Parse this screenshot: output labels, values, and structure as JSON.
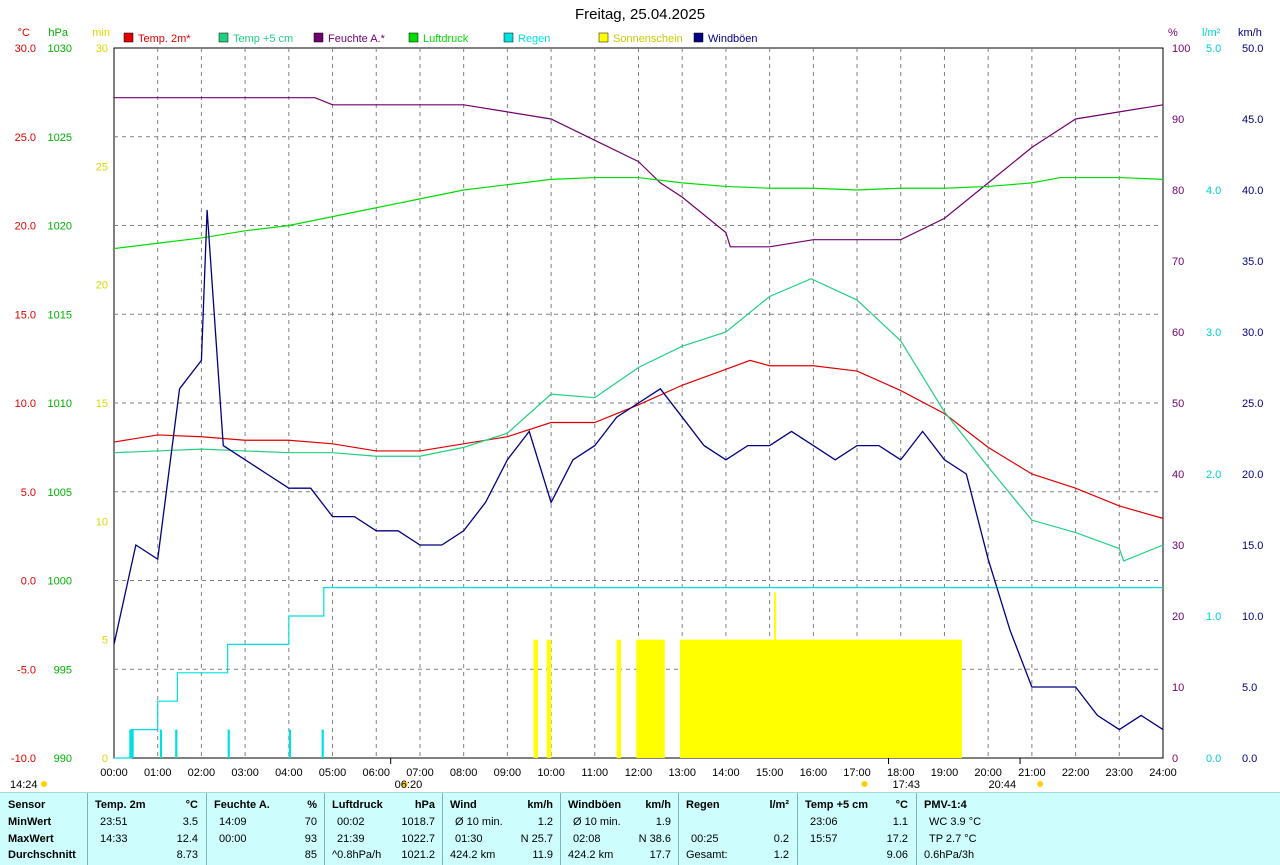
{
  "title": "Freitag, 25.04.2025",
  "colors": {
    "temp": "#e00000",
    "temp5": "#20d080",
    "hum": "#700070",
    "press": "#00dd00",
    "rain": "#00e0e0",
    "sun": "#ffff00",
    "wind": "#000080"
  },
  "chart_data": {
    "type": "line",
    "title": "Freitag, 25.04.2025",
    "x_ticks": [
      "00:00",
      "01:00",
      "02:00",
      "03:00",
      "04:00",
      "05:00",
      "06:00",
      "07:00",
      "08:00",
      "09:00",
      "10:00",
      "11:00",
      "12:00",
      "13:00",
      "14:00",
      "15:00",
      "16:00",
      "17:00",
      "18:00",
      "19:00",
      "20:00",
      "21:00",
      "22:00",
      "23:00",
      "24:00"
    ],
    "axes": {
      "temp_c": {
        "unit": "°C",
        "range": [
          -10,
          30
        ],
        "ticks": [
          "30.0",
          "25.0",
          "20.0",
          "15.0",
          "10.0",
          "5.0",
          "0.0",
          "-5.0",
          "-10.0"
        ]
      },
      "pressure_hpa": {
        "unit": "hPa",
        "range": [
          990,
          1030
        ],
        "ticks": [
          "1030",
          "1025",
          "1020",
          "1015",
          "1010",
          "1005",
          "1000",
          "995",
          "990"
        ]
      },
      "sun_min": {
        "unit": "min",
        "range": [
          0,
          30
        ],
        "ticks": [
          "30",
          "25",
          "20",
          "15",
          "10",
          "5",
          "0"
        ]
      },
      "humidity_pct": {
        "unit": "%",
        "range": [
          0,
          100
        ],
        "ticks": [
          "100",
          "90",
          "80",
          "70",
          "60",
          "50",
          "40",
          "30",
          "20",
          "10",
          "0"
        ]
      },
      "rain_lm2": {
        "unit": "l/m²",
        "range": [
          0,
          5
        ],
        "ticks": [
          "5.0",
          "4.0",
          "3.0",
          "2.0",
          "1.0",
          "0.0"
        ]
      },
      "wind_kmh": {
        "unit": "km/h",
        "range": [
          0,
          50
        ],
        "ticks": [
          "50.0",
          "45.0",
          "40.0",
          "35.0",
          "30.0",
          "25.0",
          "20.0",
          "15.0",
          "10.0",
          "5.0",
          "0.0"
        ]
      }
    },
    "legend": [
      "Temp. 2m*",
      "Temp +5 cm",
      "Feuchte A.*",
      "Luftdruck",
      "Regen",
      "Sonnenschein",
      "Windböen"
    ],
    "series": [
      {
        "name": "Temp. 2m*",
        "axis": "temp_c",
        "x": [
          0,
          1,
          2,
          3,
          4,
          5,
          6,
          7,
          8,
          9,
          10,
          11,
          12,
          13,
          14,
          14.55,
          15,
          16,
          17,
          18,
          19,
          20,
          21,
          22,
          23,
          24
        ],
        "y": [
          7.8,
          8.2,
          8.1,
          7.9,
          7.9,
          7.7,
          7.3,
          7.3,
          7.7,
          8.1,
          8.9,
          8.9,
          9.9,
          11.0,
          11.9,
          12.4,
          12.1,
          12.1,
          11.8,
          10.7,
          9.4,
          7.5,
          6.0,
          5.2,
          4.2,
          3.5
        ]
      },
      {
        "name": "Temp +5 cm",
        "axis": "temp_c",
        "x": [
          0,
          1,
          2,
          3,
          4,
          5,
          6,
          7,
          8,
          9,
          10,
          11,
          12,
          13,
          14,
          15,
          15.95,
          17,
          18,
          19,
          20,
          21,
          22,
          23,
          23.1,
          24
        ],
        "y": [
          7.2,
          7.3,
          7.4,
          7.3,
          7.2,
          7.2,
          7.0,
          7.0,
          7.5,
          8.3,
          10.5,
          10.3,
          12.0,
          13.2,
          14.0,
          16.0,
          17.0,
          15.8,
          13.5,
          9.5,
          6.4,
          3.4,
          2.7,
          1.8,
          1.1,
          2.0
        ]
      },
      {
        "name": "Feuchte A.*",
        "axis": "humidity_pct",
        "x": [
          0,
          1,
          2,
          3,
          4,
          4.6,
          5,
          6,
          7,
          8,
          9,
          10,
          11,
          12,
          12.5,
          13,
          14,
          14.1,
          15,
          16,
          17,
          18,
          19,
          19.8,
          20,
          21,
          22,
          23,
          24
        ],
        "y": [
          93,
          93,
          93,
          93,
          93,
          93,
          92,
          92,
          92,
          92,
          91,
          90,
          87,
          84,
          81,
          79,
          74,
          72,
          72,
          73,
          73,
          73,
          76,
          80,
          81,
          86,
          90,
          91,
          92
        ]
      },
      {
        "name": "Luftdruck",
        "axis": "pressure_hpa",
        "x": [
          0,
          1,
          2,
          3,
          4,
          5,
          6,
          7,
          8,
          9,
          10,
          11,
          12,
          13,
          14,
          15,
          16,
          17,
          18,
          19,
          20,
          21,
          21.65,
          22,
          23,
          24
        ],
        "y": [
          1018.7,
          1019.0,
          1019.3,
          1019.7,
          1020.0,
          1020.5,
          1021.0,
          1021.5,
          1022.0,
          1022.3,
          1022.6,
          1022.7,
          1022.7,
          1022.4,
          1022.2,
          1022.1,
          1022.1,
          1022.0,
          1022.1,
          1022.1,
          1022.2,
          1022.4,
          1022.7,
          1022.7,
          1022.7,
          1022.6
        ]
      },
      {
        "name": "Regen",
        "axis": "rain_lm2",
        "type": "step",
        "x": [
          0,
          0.4,
          1.0,
          1.45,
          2.6,
          4.0,
          4.8,
          5.5,
          24
        ],
        "y": [
          0.0,
          0.2,
          0.4,
          0.6,
          0.8,
          1.0,
          1.2,
          1.2,
          1.2
        ]
      },
      {
        "name": "Windböen",
        "axis": "wind_kmh",
        "x": [
          0,
          0.5,
          1,
          1.5,
          2,
          2.13,
          2.5,
          3,
          3.5,
          4,
          4.5,
          5,
          5.5,
          6,
          6.5,
          7,
          7.5,
          8,
          8.5,
          9,
          9.5,
          10,
          10.5,
          11,
          11.5,
          12,
          12.5,
          13,
          13.5,
          14,
          14.5,
          15,
          15.5,
          16,
          16.5,
          17,
          17.5,
          18,
          18.5,
          19,
          19.5,
          20,
          20.5,
          21,
          21.5,
          22,
          22.5,
          23,
          23.5,
          24
        ],
        "y": [
          8,
          15,
          14,
          26,
          28,
          38.6,
          22,
          21,
          20,
          19,
          19,
          17,
          17,
          16,
          16,
          15,
          15,
          16,
          18,
          21,
          23,
          18,
          21,
          22,
          24,
          25,
          26,
          24,
          22,
          21,
          22,
          22,
          23,
          22,
          21,
          22,
          22,
          21,
          23,
          21,
          20,
          14,
          9,
          5,
          5,
          5,
          3,
          2,
          3,
          2
        ]
      }
    ],
    "bars": [
      {
        "name": "Sonnenschein",
        "axis": "sun_min",
        "spans": [
          [
            9.6,
            9.7
          ],
          [
            9.9,
            10.0
          ],
          [
            11.5,
            11.6
          ],
          [
            11.95,
            12.6
          ],
          [
            12.95,
            19.4
          ]
        ],
        "value": 5,
        "peak": {
          "x": 15.1,
          "value": 7
        }
      },
      {
        "name": "Regen",
        "axis": "sun_min",
        "spans": [
          [
            0.35,
            0.45
          ],
          [
            1.05,
            1.1
          ],
          [
            1.4,
            1.45
          ],
          [
            2.6,
            2.65
          ],
          [
            4.0,
            4.05
          ],
          [
            4.75,
            4.8
          ]
        ],
        "value": 1.2
      }
    ],
    "markers": [
      {
        "label": "06:20",
        "x": 6.33
      },
      {
        "label": "17:43",
        "x": 17.72
      },
      {
        "label": "20:44",
        "x": 20.73
      }
    ],
    "corner_label": "14:24",
    "grid": true
  },
  "stats": {
    "labels": [
      "Sensor",
      "MinWert",
      "MaxWert",
      "Durchschnitt"
    ],
    "groups": [
      {
        "title": "Temp. 2m",
        "unit": "°C",
        "min_time": "23:51",
        "min_val": "3.5",
        "max_time": "14:33",
        "max_val": "12.4",
        "avg_time": "",
        "avg_val": "8.73"
      },
      {
        "title": "Feuchte A.",
        "unit": "%",
        "min_time": "14:09",
        "min_val": "70",
        "max_time": "00:00",
        "max_val": "93",
        "avg_time": "",
        "avg_val": "85"
      },
      {
        "title": "Luftdruck",
        "unit": "hPa",
        "min_time": "00:02",
        "min_val": "1018.7",
        "max_time": "21:39",
        "max_val": "1022.7",
        "avg_time": "^0.8hPa/h",
        "avg_val": "1021.2"
      },
      {
        "title": "Wind",
        "unit": "km/h",
        "min_time": "Ø 10 min.",
        "min_val": "1.2",
        "max_time": "01:30",
        "max_val": "N 25.7",
        "avg_time": "424.2 km",
        "avg_val": "11.9"
      },
      {
        "title": "Windböen",
        "unit": "km/h",
        "min_time": "Ø 10 min.",
        "min_val": "1.9",
        "max_time": "02:08",
        "max_val": "N 38.6",
        "avg_time": "424.2 km",
        "avg_val": "17.7"
      },
      {
        "title": "Regen",
        "unit": "l/m²",
        "min_time": "",
        "min_val": "",
        "max_time": "00:25",
        "max_val": "0.2",
        "avg_time": "Gesamt:",
        "avg_val": "1.2"
      },
      {
        "title": "Temp +5 cm",
        "unit": "°C",
        "min_time": "23:06",
        "min_val": "1.1",
        "max_time": "15:57",
        "max_val": "17.2",
        "avg_time": "",
        "avg_val": "9.06"
      },
      {
        "title": "PMV-1:4",
        "unit": "",
        "min_time": "WC 3.9 °C",
        "min_val": "",
        "max_time": "TP 2.7 °C",
        "max_val": "",
        "avg_time": "0.6hPa/3h",
        "avg_val": ""
      }
    ]
  }
}
